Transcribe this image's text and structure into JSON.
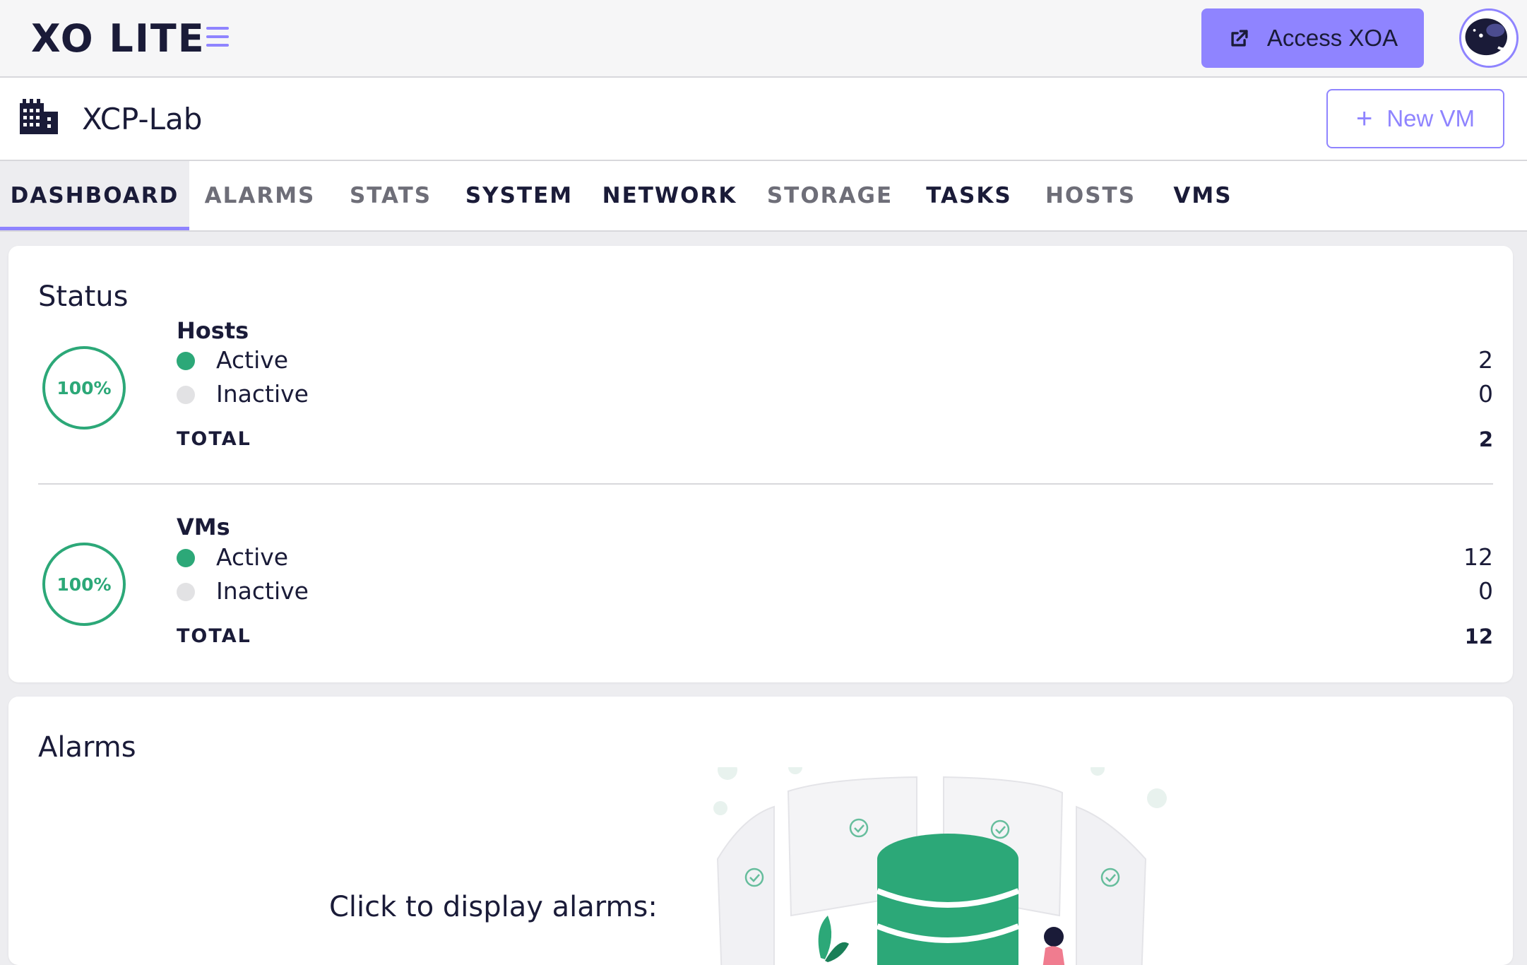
{
  "topbar": {
    "logo": "XO LITE",
    "access_label": "Access XOA"
  },
  "pool": {
    "name": "XCP-Lab",
    "new_vm_label": "New VM"
  },
  "tabs": [
    {
      "label": "DASHBOARD",
      "active": true
    },
    {
      "label": "ALARMS",
      "active": false
    },
    {
      "label": "STATS",
      "active": false
    },
    {
      "label": "SYSTEM",
      "active": false
    },
    {
      "label": "NETWORK",
      "active": false
    },
    {
      "label": "STORAGE",
      "active": false
    },
    {
      "label": "TASKS",
      "active": false
    },
    {
      "label": "HOSTS",
      "active": false
    },
    {
      "label": "VMS",
      "active": false
    }
  ],
  "status": {
    "title": "Status",
    "hosts": {
      "title": "Hosts",
      "percent": "100%",
      "active_label": "Active",
      "active_count": "2",
      "inactive_label": "Inactive",
      "inactive_count": "0",
      "total_label": "TOTAL",
      "total_count": "2"
    },
    "vms": {
      "title": "VMs",
      "percent": "100%",
      "active_label": "Active",
      "active_count": "12",
      "inactive_label": "Inactive",
      "inactive_count": "0",
      "total_label": "TOTAL",
      "total_count": "12"
    }
  },
  "alarms": {
    "title": "Alarms",
    "cta": "Click to display alarms:"
  },
  "colors": {
    "accent": "#8f84ff",
    "success": "#2ca878",
    "inactive_dot": "#e2e2e4",
    "text_dark": "#1a1b38"
  }
}
